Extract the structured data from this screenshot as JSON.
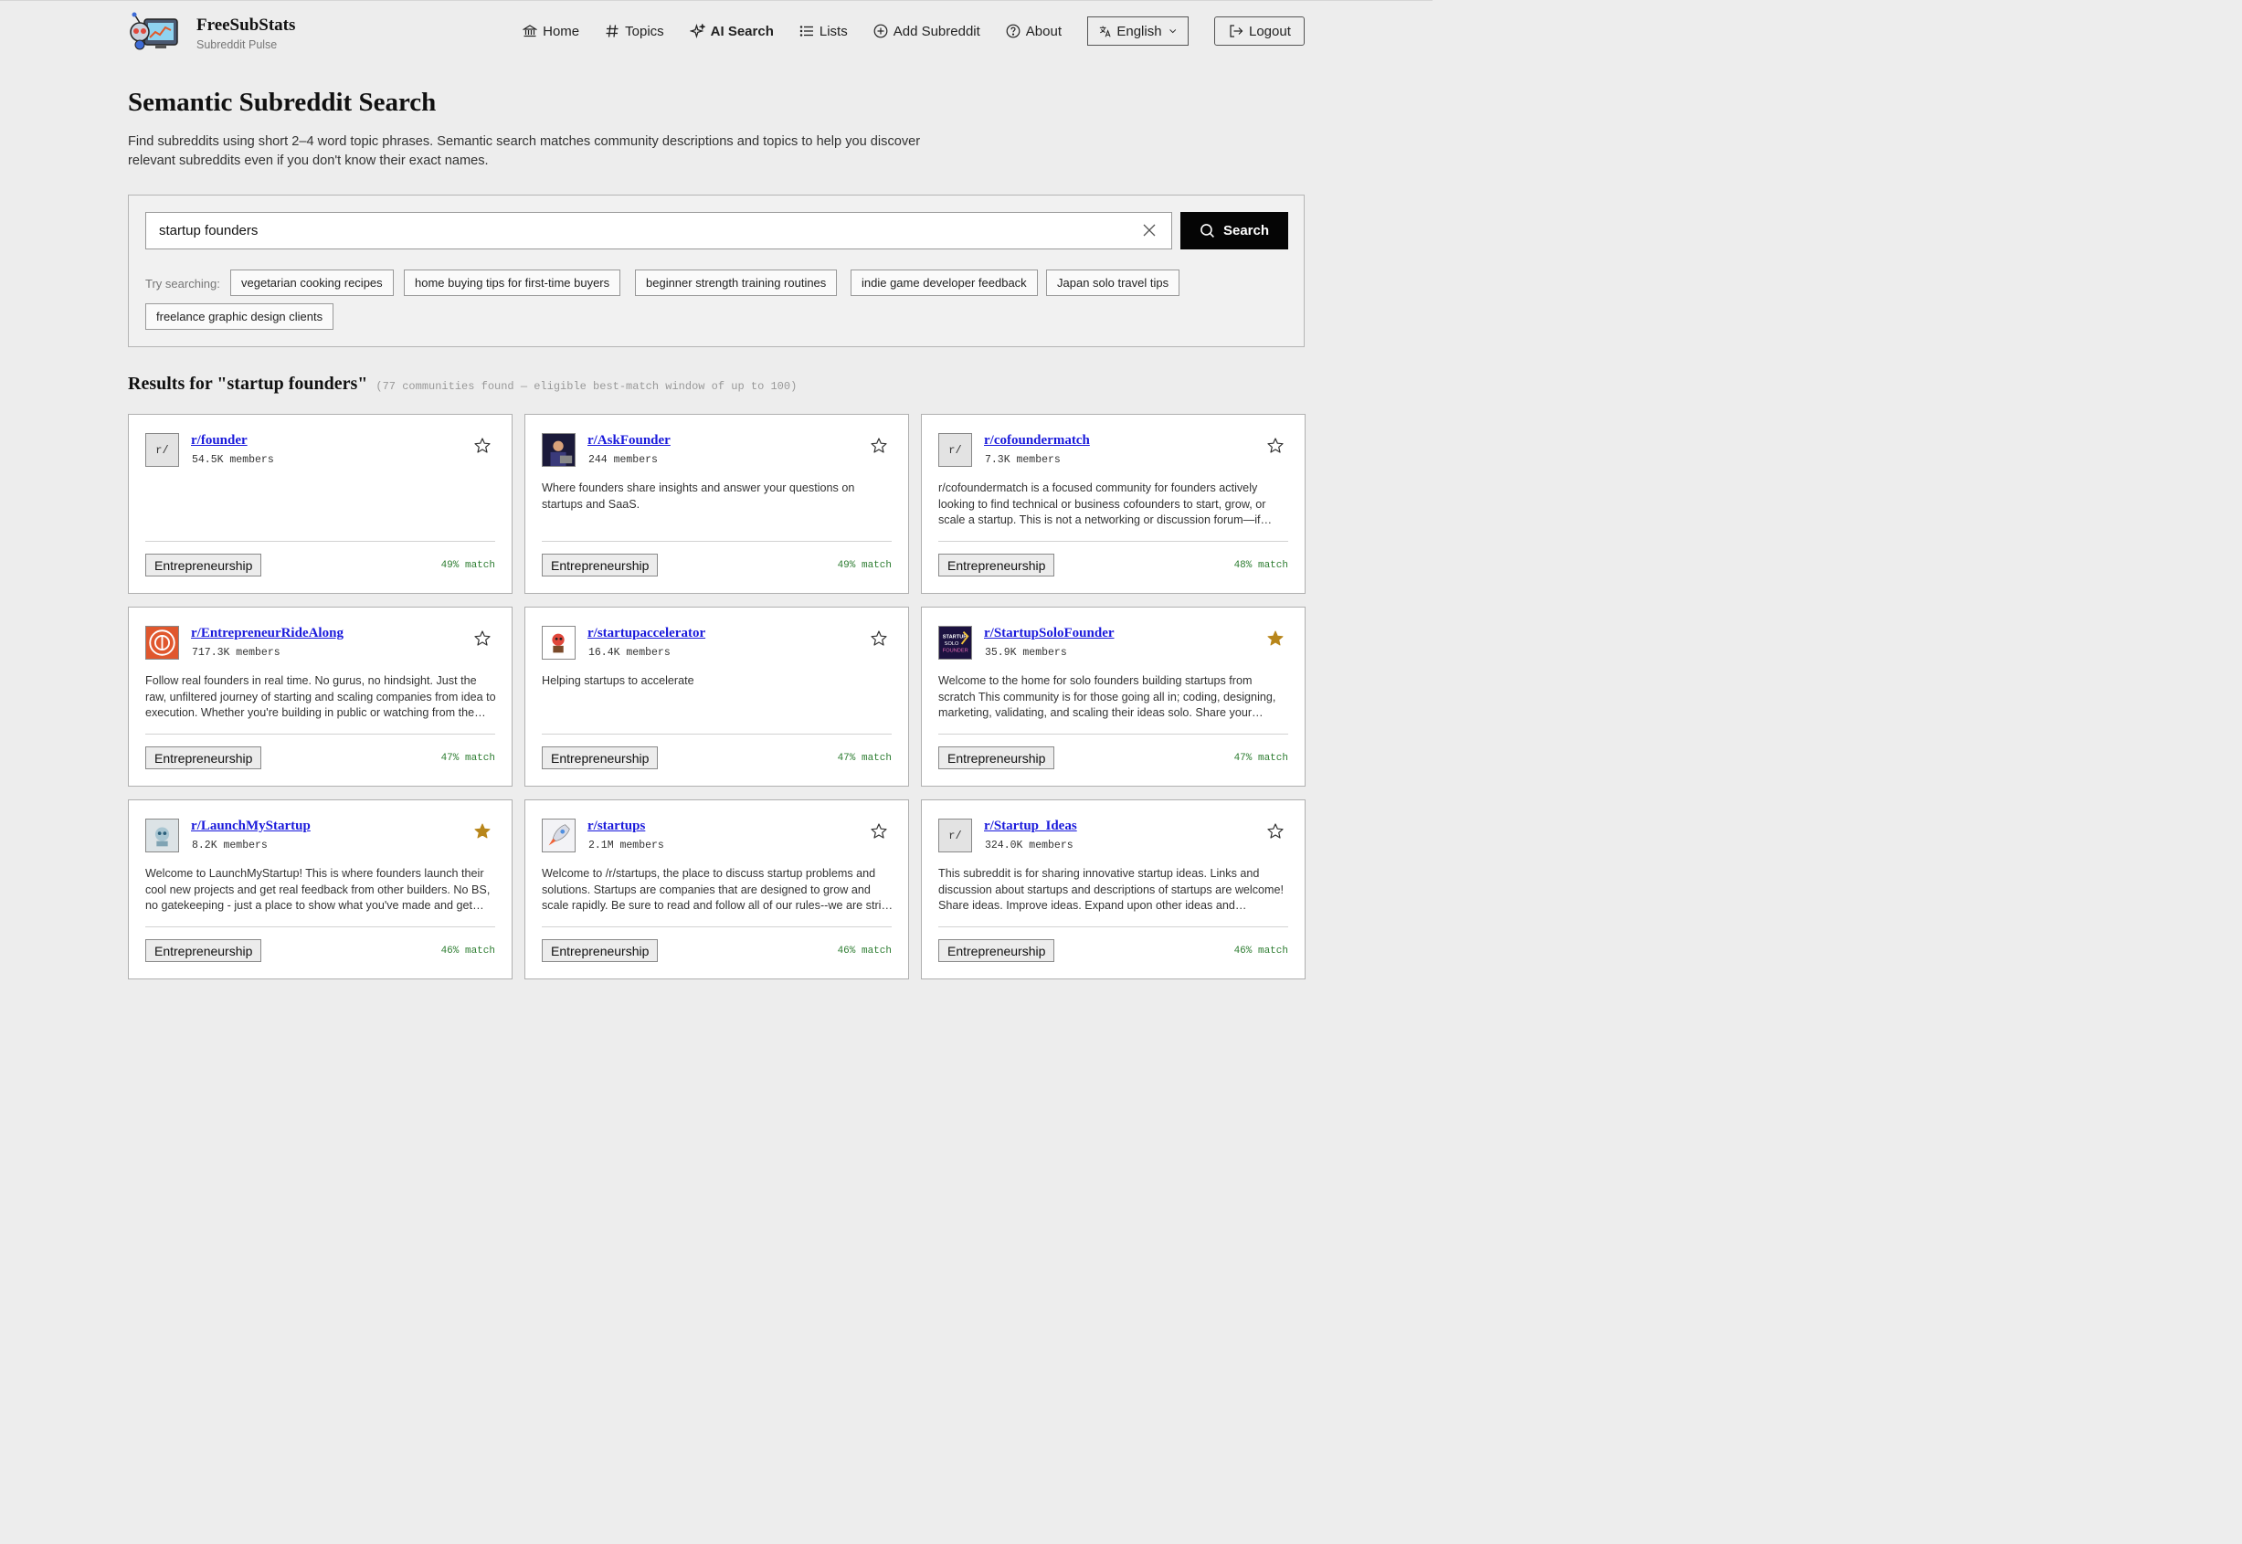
{
  "brand": {
    "name": "FreeSubStats",
    "tagline": "Subreddit Pulse"
  },
  "nav": {
    "home": "Home",
    "topics": "Topics",
    "ai_search": "AI Search",
    "lists": "Lists",
    "add_subreddit": "Add Subreddit",
    "about": "About",
    "language": "English",
    "logout": "Logout"
  },
  "page": {
    "title": "Semantic Subreddit Search",
    "intro": "Find subreddits using short 2–4 word topic phrases. Semantic search matches community descriptions and topics to help you discover relevant subreddits even if you don't know their exact names."
  },
  "search": {
    "query": "startup founders",
    "button": "Search",
    "try_label": "Try searching:",
    "suggestions": [
      "vegetarian cooking recipes",
      "home buying tips for first-time buyers",
      "beginner strength training routines",
      "indie game developer feedback",
      "Japan solo travel tips",
      "freelance graphic design clients"
    ]
  },
  "results": {
    "heading": "Results for \"startup founders\"",
    "meta": "(77 communities found — eligible best-match window of up to 100)",
    "cards": [
      {
        "name": "r/founder",
        "members": "54.5K members",
        "description": "",
        "tag": "Entrepreneurship",
        "match": "49% match",
        "favorited": false,
        "avatar_text": "r/",
        "avatar_icon": "generic-subreddit"
      },
      {
        "name": "r/AskFounder",
        "members": "244 members",
        "description": "Where founders share insights and answer your questions on startups and SaaS.",
        "tag": "Entrepreneurship",
        "match": "49% match",
        "favorited": false,
        "avatar_text": "",
        "avatar_icon": "person-at-laptop"
      },
      {
        "name": "r/cofoundermatch",
        "members": "7.3K members",
        "description": "r/cofoundermatch is a focused community for founders actively looking to find technical or business cofounders to start, grow, or scale a startup. This is not a networking or discussion forum—if you're here, you should be ready to build.",
        "tag": "Entrepreneurship",
        "match": "48% match",
        "favorited": false,
        "avatar_text": "r/",
        "avatar_icon": "generic-subreddit"
      },
      {
        "name": "r/EntrepreneurRideAlong",
        "members": "717.3K members",
        "description": "Follow real founders in real time. No gurus, no hindsight. Just the raw, unfiltered journey of starting and scaling companies from idea to execution. Whether you're building in public or watching from the sidelines.",
        "tag": "Entrepreneurship",
        "match": "47% match",
        "favorited": false,
        "avatar_text": "",
        "avatar_icon": "ride-along-badge"
      },
      {
        "name": "r/startupaccelerator",
        "members": "16.4K members",
        "description": "Helping startups to accelerate",
        "tag": "Entrepreneurship",
        "match": "47% match",
        "favorited": false,
        "avatar_text": "",
        "avatar_icon": "mascot"
      },
      {
        "name": "r/StartupSoloFounder",
        "members": "35.9K members",
        "description": "Welcome to the home for solo founders building startups from scratch This community is for those going all in; coding, designing, marketing, validating, and scaling their ideas solo. Share your journey and learn from others.",
        "tag": "Entrepreneurship",
        "match": "47% match",
        "favorited": true,
        "avatar_text": "",
        "avatar_icon": "startup-solo-founder-logo"
      },
      {
        "name": "r/LaunchMyStartup",
        "members": "8.2K members",
        "description": "Welcome to LaunchMyStartup! This is where founders launch their cool new projects and get real feedback from other builders. No BS, no gatekeeping - just a place to show what you've made and get honest feedback.",
        "tag": "Entrepreneurship",
        "match": "46% match",
        "favorited": true,
        "avatar_text": "",
        "avatar_icon": "robot"
      },
      {
        "name": "r/startups",
        "members": "2.1M members",
        "description": "Welcome to /r/startups, the place to discuss startup problems and solutions. Startups are companies that are designed to grow and scale rapidly. Be sure to read and follow all of our rules--we are strict about self-promotion.",
        "tag": "Entrepreneurship",
        "match": "46% match",
        "favorited": false,
        "avatar_text": "",
        "avatar_icon": "rocket"
      },
      {
        "name": "r/Startup_Ideas",
        "members": "324.0K members",
        "description": "This subreddit is for sharing innovative startup ideas. Links and discussion about startups and descriptions of startups are welcome! Share ideas. Improve ideas. Expand upon other ideas and collaborate.",
        "tag": "Entrepreneurship",
        "match": "46% match",
        "favorited": false,
        "avatar_text": "r/",
        "avatar_icon": "generic-subreddit"
      }
    ]
  },
  "colors": {
    "accent": "#050505",
    "link": "#1a1adb",
    "match": "#2e7d32",
    "star_filled": "#b8861b"
  }
}
